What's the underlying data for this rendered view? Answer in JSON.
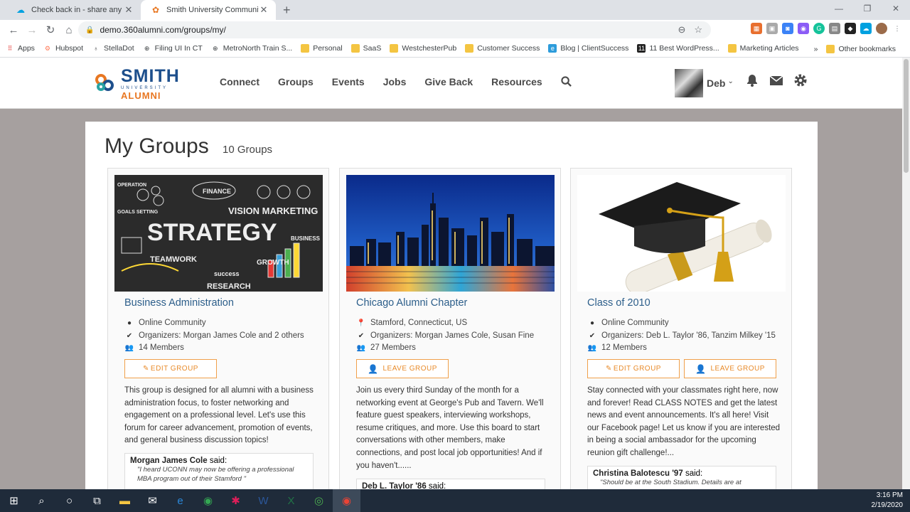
{
  "browser": {
    "tabs": [
      {
        "title": "Check back in - share any enhanc",
        "active": false
      },
      {
        "title": "Smith University Community - Gr",
        "active": true
      }
    ],
    "url": "demo.360alumni.com/groups/my/",
    "bookmarks": [
      "Apps",
      "Hubspot",
      "StellaDot",
      "Filing UI In CT",
      "MetroNorth Train S...",
      "Personal",
      "SaaS",
      "WestchesterPub",
      "Customer Success",
      "Blog | ClientSuccess",
      "11 Best WordPress...",
      "Marketing Articles"
    ],
    "other_bookmarks": "Other bookmarks",
    "overflow": "»"
  },
  "site": {
    "logo": {
      "line1": "SMITH",
      "line2": "UNIVERSITY",
      "line3": "ALUMNI"
    },
    "nav": [
      "Connect",
      "Groups",
      "Events",
      "Jobs",
      "Give Back",
      "Resources"
    ],
    "user_name": "Deb"
  },
  "page": {
    "title": "My Groups",
    "count": "10 Groups"
  },
  "groups": [
    {
      "name": "Business Administration",
      "line1": "Online Community",
      "line2": "Organizers: Morgan James Cole and 2 others",
      "line3": "14 Members",
      "buttons": [
        "EDIT GROUP"
      ],
      "description": "This group is designed for all alumni with a business administration focus, to foster networking and engagement on a professional level.  Let's use this forum for career advancement, promotion of events, and general business discussion topics!",
      "quote_author": "Morgan James Cole",
      "quote_said": "said:",
      "quote_text": "\"I heard UCONN may now be offering a professional MBA program out of their Stamford \""
    },
    {
      "name": "Chicago Alumni Chapter",
      "line1": "Stamford, Connecticut, US",
      "line2": "Organizers: Morgan James Cole, Susan Fine",
      "line3": "27 Members",
      "buttons": [
        "LEAVE GROUP"
      ],
      "description": "Join us every third Sunday of the month for a networking event at George's Pub and Tavern. We'll feature guest speakers, interviewing workshops, resume critiques, and more. Use this board to start conversations with other members, make connections, and post local job opportunities! And if you haven't......",
      "quote_author": "Deb L. Taylor '86",
      "quote_said": "said:",
      "quote_text": ""
    },
    {
      "name": "Class of 2010",
      "line1": "Online Community",
      "line2": "Organizers: Deb L. Taylor '86, Tanzim Milkey '15",
      "line3": "12 Members",
      "buttons": [
        "EDIT GROUP",
        "LEAVE GROUP"
      ],
      "description": "Stay connected with your classmates right here, now and forever! Read CLASS NOTES and get the latest news and event announcements. It's all here! Visit our Facebook page!  Let us know if you are interested in being a social ambassador for the upcoming reunion gift challenge!...",
      "quote_author": "Christina Balotescu '97",
      "quote_said": "said:",
      "quote_text": "\"Should be at the South Stadium. Details are at"
    }
  ],
  "taskbar": {
    "time": "3:16 PM",
    "date": "2/19/2020"
  }
}
